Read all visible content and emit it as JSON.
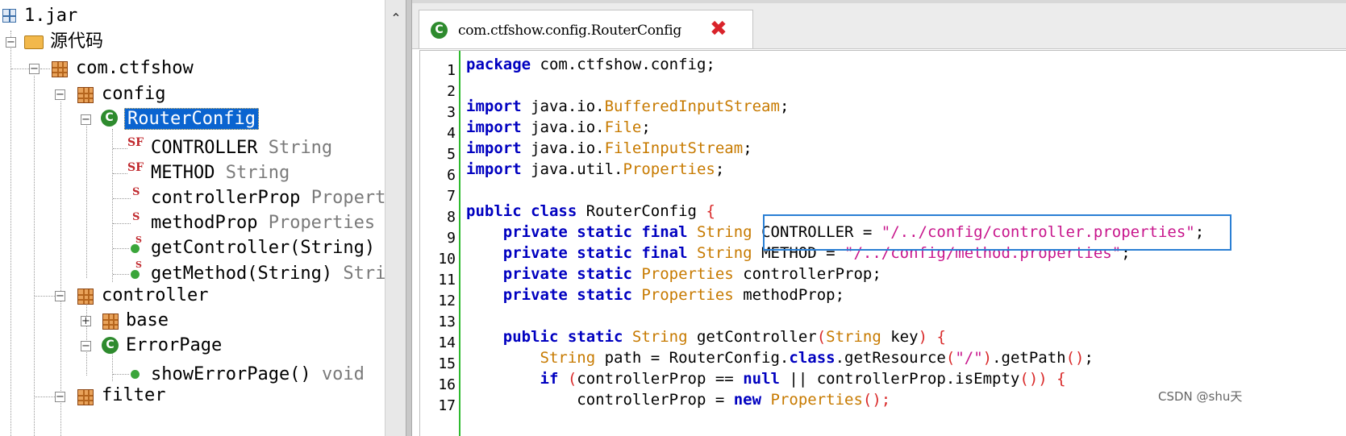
{
  "tree": {
    "root": "1.jar",
    "source": "源代码",
    "package": "com.ctfshow",
    "config": "config",
    "router_config": "RouterConfig",
    "items": [
      {
        "name": "CONTROLLER",
        "sig": "String"
      },
      {
        "name": "METHOD",
        "sig": "String"
      },
      {
        "name": "controllerProp",
        "sig": "Propert"
      },
      {
        "name": "methodProp",
        "sig": "Properties"
      },
      {
        "name": "getController(String)",
        "sig": ""
      },
      {
        "name": "getMethod(String)",
        "sig": "Stri"
      }
    ],
    "controller": "controller",
    "base": "base",
    "error_page": "ErrorPage",
    "show_error": {
      "name": "showErrorPage()",
      "sig": "void"
    },
    "filter": "filter",
    "field_icon_text": "SF",
    "static_icon_text": "S",
    "class_icon_text": "C"
  },
  "editor": {
    "tab_title": "com.ctfshow.config.RouterConfig",
    "tab_close": "✖",
    "line_numbers": [
      "1",
      "2",
      "3",
      "4",
      "5",
      "6",
      "7",
      "8",
      "9",
      "10",
      "11",
      "12",
      "13",
      "14",
      "15",
      "16",
      "17"
    ],
    "code": {
      "l1_kw": "package",
      "l1_rest": " com.ctfshow.config;",
      "import_kw": "import",
      "l3_pre": " java.io.",
      "l3_ty": "BufferedInputStream",
      "l4_pre": " java.io.",
      "l4_ty": "File",
      "l5_pre": " java.io.",
      "l5_ty": "FileInputStream",
      "l6_pre": " java.util.",
      "l6_ty": "Properties",
      "semi": ";",
      "l8_kw": "public class",
      "l8_name": " RouterConfig ",
      "l8_brace": "{",
      "l9_kw": "    private static final",
      "l9_ty": " String",
      "l9_name": " CONTROLLER = ",
      "l9_str": "\"/../config/controller.properties\"",
      "l10_kw": "    private static final",
      "l10_ty": " String",
      "l10_name": " METHOD = ",
      "l10_str": "\"/../config/method.properties\"",
      "l11_kw": "    private static",
      "l11_ty": " Properties",
      "l11_name": " controllerProp;",
      "l12_kw": "    private static",
      "l12_ty": " Properties",
      "l12_name": " methodProp;",
      "l14_kw": "    public static",
      "l14_ty": " String",
      "l14_name": " getController",
      "l14_p1": "(",
      "l14_ty2": "String",
      "l14_arg": " key",
      "l14_p2": ") {",
      "l15_ty": "        String",
      "l15_a": " path = RouterConfig.",
      "l15_kw": "class",
      "l15_b": ".getResource",
      "l15_p1": "(",
      "l15_str": "\"/\"",
      "l15_p2": ")",
      "l15_c": ".getPath",
      "l15_p3": "()",
      "l15_d": ";",
      "l16_kw": "        if",
      "l16_p1": " (",
      "l16_a": "controllerProp == ",
      "l16_kw2": "null",
      "l16_b": " || controllerProp.isEmpty",
      "l16_p2": "()) {",
      "l17_a": "            controllerProp = ",
      "l17_kw": "new",
      "l17_ty": " Properties",
      "l17_p": "();"
    }
  },
  "watermark": "CSDN @shu天"
}
